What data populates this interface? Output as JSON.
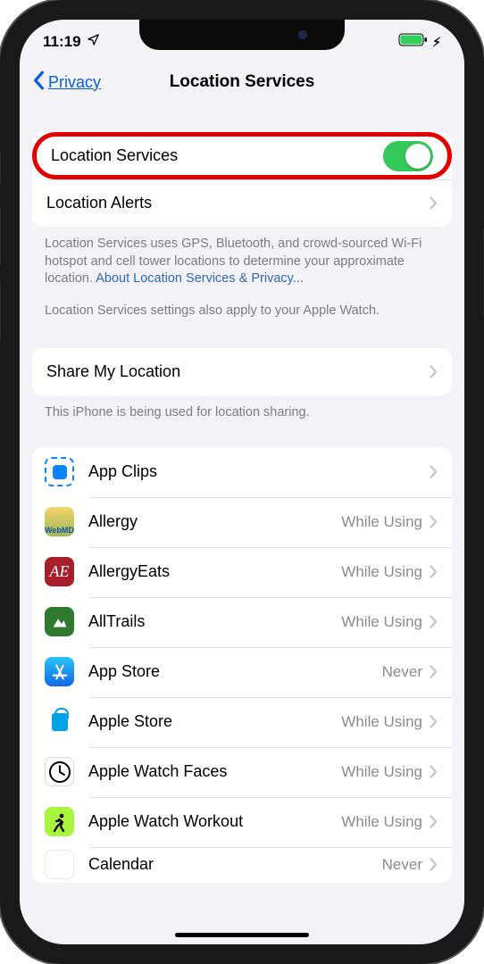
{
  "status": {
    "time": "11:19"
  },
  "nav": {
    "back_label": "Privacy",
    "title": "Location Services"
  },
  "group1": {
    "location_services_label": "Location Services",
    "location_alerts_label": "Location Alerts"
  },
  "info1_a": "Location Services uses GPS, Bluetooth, and crowd-sourced Wi-Fi hotspot and cell tower locations to determine your approximate location. ",
  "info1_link": "About Location Services & Privacy...",
  "info1_b": "Location Services settings also apply to your Apple Watch.",
  "group2": {
    "share_label": "Share My Location"
  },
  "info2": "This iPhone is being used for location sharing.",
  "apps": {
    "cell0": {
      "label": "App Clips",
      "status": ""
    },
    "cell1": {
      "label": "Allergy",
      "status": "While Using",
      "iconText": "WebMD"
    },
    "cell2": {
      "label": "AllergyEats",
      "status": "While Using",
      "iconText": "AE"
    },
    "cell3": {
      "label": "AllTrails",
      "status": "While Using"
    },
    "cell4": {
      "label": "App Store",
      "status": "Never"
    },
    "cell5": {
      "label": "Apple Store",
      "status": "While Using"
    },
    "cell6": {
      "label": "Apple Watch Faces",
      "status": "While Using"
    },
    "cell7": {
      "label": "Apple Watch Workout",
      "status": "While Using"
    },
    "cell8": {
      "label": "Calendar",
      "status": "Never"
    }
  }
}
